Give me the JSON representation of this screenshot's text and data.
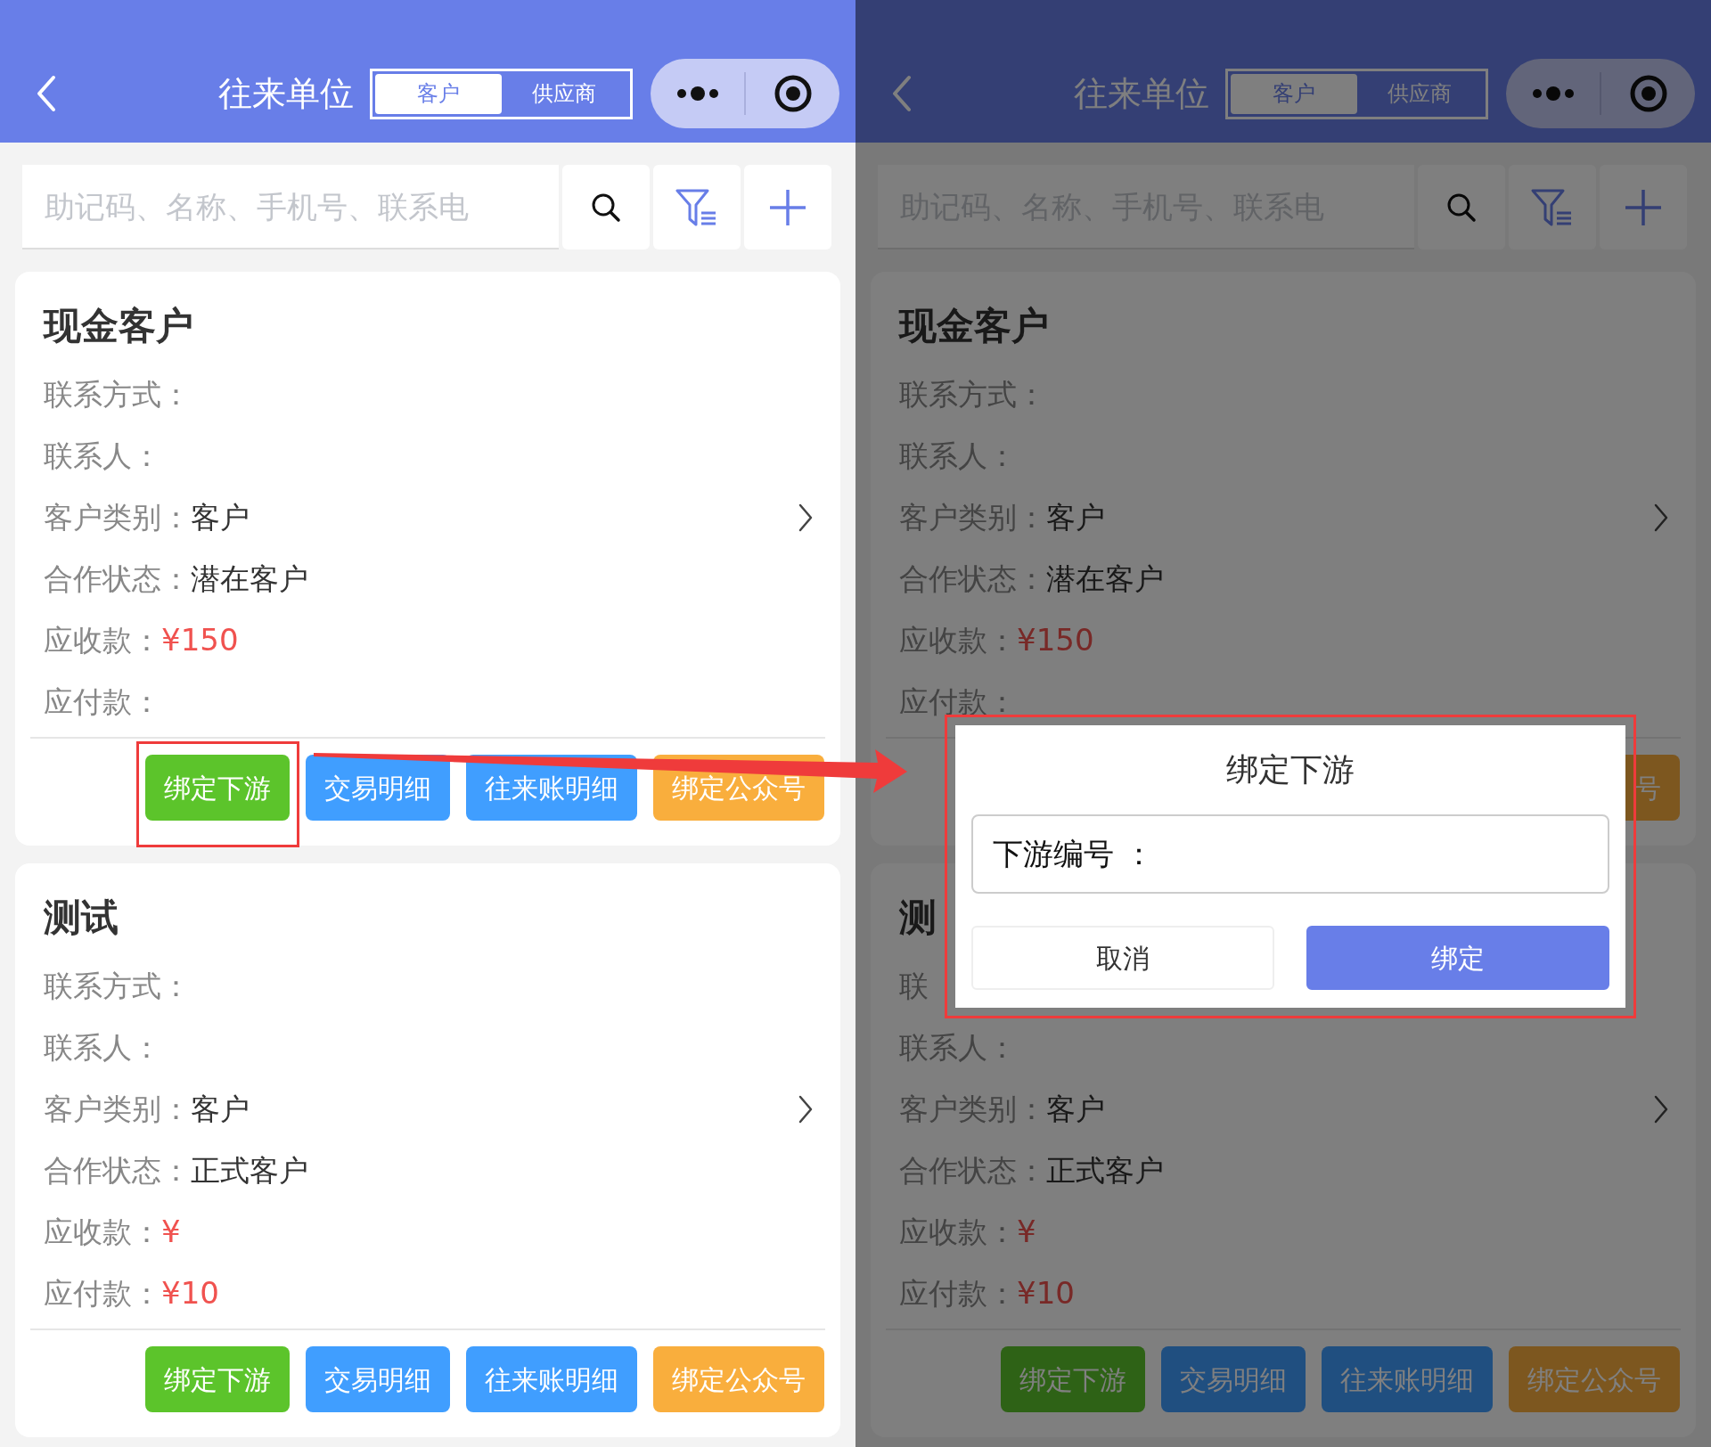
{
  "panels": [
    {
      "dimmed": false,
      "header": {
        "title": "往来单位",
        "tabs": [
          {
            "label": "客户",
            "selected": true
          },
          {
            "label": "供应商",
            "selected": false
          }
        ]
      },
      "search": {
        "placeholder": "助记码、名称、手机号、联系电"
      },
      "cards": [
        {
          "title": "现金客户",
          "fields": [
            {
              "label": "联系方式：",
              "kind": "text"
            },
            {
              "label": "联系人：",
              "kind": "text"
            },
            {
              "label": "客户类别：",
              "value": "客户",
              "kind": "link"
            },
            {
              "label": "合作状态：",
              "value": "潜在客户",
              "kind": "text"
            },
            {
              "label": "应收款：",
              "value": "¥150",
              "kind": "amount"
            },
            {
              "label": "应付款：",
              "kind": "amount"
            }
          ],
          "buttons": [
            {
              "label": "绑定下游",
              "color": "#5cc42b",
              "highlighted": true
            },
            {
              "label": "交易明细",
              "color": "#409eff",
              "highlighted": false
            },
            {
              "label": "往来账明细",
              "color": "#409eff",
              "highlighted": false
            },
            {
              "label": "绑定公众号",
              "color": "#f9ae3d",
              "highlighted": false
            }
          ]
        },
        {
          "title": "测试",
          "fields": [
            {
              "label": "联系方式：",
              "kind": "text"
            },
            {
              "label": "联系人：",
              "kind": "text"
            },
            {
              "label": "客户类别：",
              "value": "客户",
              "kind": "link"
            },
            {
              "label": "合作状态：",
              "value": "正式客户",
              "kind": "text"
            },
            {
              "label": "应收款：",
              "value": "¥",
              "kind": "amount"
            },
            {
              "label": "应付款：",
              "value": "¥10",
              "kind": "amount"
            }
          ],
          "buttons": [
            {
              "label": "绑定下游",
              "color": "#5cc42b",
              "highlighted": false
            },
            {
              "label": "交易明细",
              "color": "#409eff",
              "highlighted": false
            },
            {
              "label": "往来账明细",
              "color": "#409eff",
              "highlighted": false
            },
            {
              "label": "绑定公众号",
              "color": "#f9ae3d",
              "highlighted": false
            }
          ]
        }
      ]
    },
    {
      "dimmed": true,
      "header": {
        "title": "往来单位",
        "tabs": [
          {
            "label": "客户",
            "selected": true
          },
          {
            "label": "供应商",
            "selected": false
          }
        ]
      },
      "search": {
        "placeholder": "助记码、名称、手机号、联系电"
      },
      "cards": [
        {
          "title": "现金客户",
          "fields": [
            {
              "label": "联系方式：",
              "kind": "text"
            },
            {
              "label": "联系人：",
              "kind": "text"
            },
            {
              "label": "客户类别：",
              "value": "客户",
              "kind": "link"
            },
            {
              "label": "合作状态：",
              "value": "潜在客户",
              "kind": "text"
            },
            {
              "label": "应收款：",
              "value": "¥150",
              "kind": "amount"
            },
            {
              "label": "应付款：",
              "kind": "amount"
            }
          ],
          "buttons": [
            {
              "label": "号",
              "color": "#7d571f",
              "highlighted": false
            }
          ]
        },
        {
          "title": "测",
          "fields": [
            {
              "label": "联",
              "kind": "text"
            },
            {
              "label": "联系人：",
              "kind": "text"
            },
            {
              "label": "客户类别：",
              "value": "客户",
              "kind": "link"
            },
            {
              "label": "合作状态：",
              "value": "正式客户",
              "kind": "text"
            },
            {
              "label": "应收款：",
              "value": "¥",
              "kind": "amount"
            },
            {
              "label": "应付款：",
              "value": "¥10",
              "kind": "amount"
            }
          ],
          "buttons": [
            {
              "label": "绑定下游",
              "color": "#2e6216",
              "highlighted": false
            },
            {
              "label": "交易明细",
              "color": "#204f80",
              "highlighted": false
            },
            {
              "label": "往来账明细",
              "color": "#204f80",
              "highlighted": false
            },
            {
              "label": "绑定公众号",
              "color": "#7d571f",
              "highlighted": false
            }
          ]
        }
      ]
    }
  ],
  "dialog": {
    "title": "绑定下游",
    "field_label": "下游编号 ：",
    "buttons": [
      {
        "label": "取消",
        "kind": "cancel"
      },
      {
        "label": "绑定",
        "kind": "confirm"
      }
    ],
    "highlighted": true
  }
}
